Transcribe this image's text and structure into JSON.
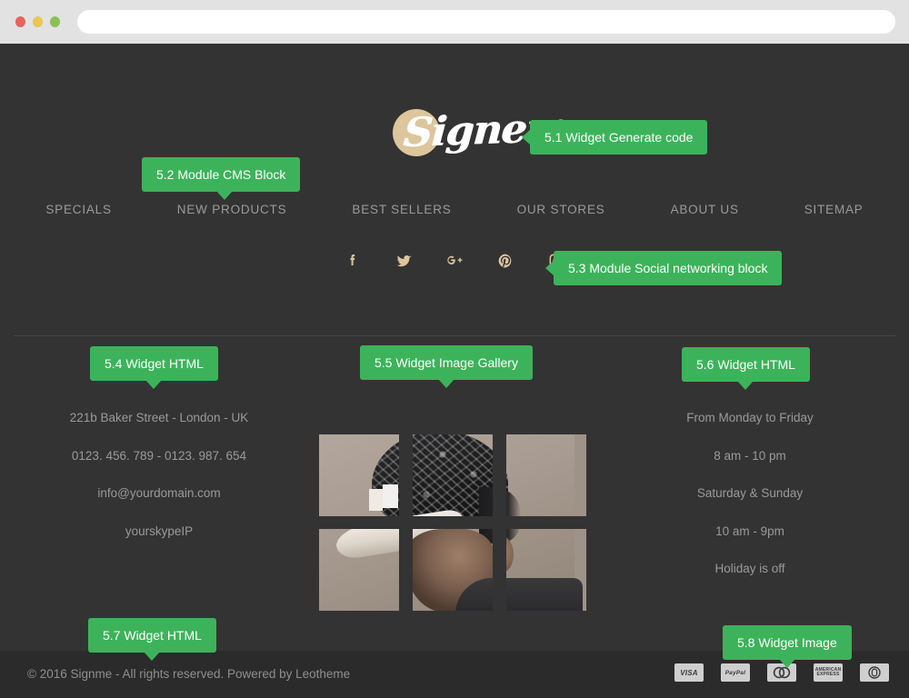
{
  "browser": {
    "url_value": "",
    "url_placeholder": "",
    "buttons": [
      "close",
      "minimize",
      "maximize"
    ]
  },
  "site": {
    "logo_text": "Signem",
    "nav": [
      {
        "label": "SPECIALS"
      },
      {
        "label": "NEW PRODUCTS"
      },
      {
        "label": "BEST SELLERS"
      },
      {
        "label": "OUR STORES"
      },
      {
        "label": "ABOUT US"
      },
      {
        "label": "SITEMAP"
      }
    ],
    "socials": [
      {
        "name": "facebook-icon",
        "label": "Facebook"
      },
      {
        "name": "twitter-icon",
        "label": "Twitter"
      },
      {
        "name": "google-plus-icon",
        "label": "Google Plus"
      },
      {
        "name": "pinterest-icon",
        "label": "Pinterest"
      },
      {
        "name": "instagram-icon",
        "label": "Instagram"
      }
    ],
    "contact": {
      "address": "221b Baker Street - London - UK",
      "phone": "0123. 456. 789 - 0123. 987. 654",
      "email": "info@yourdomain.com",
      "skype": "yourskypeIP"
    },
    "hours": {
      "line1": "From Monday to Friday",
      "line2": "8 am - 10 pm",
      "line3": "Saturday & Sunday",
      "line4": "10 am - 9pm",
      "line5": "Holiday is off"
    },
    "gallery": {
      "tiles": [
        {
          "alt": "gallery-tile-1"
        },
        {
          "alt": "gallery-tile-2"
        },
        {
          "alt": "gallery-tile-3"
        },
        {
          "alt": "gallery-tile-4"
        },
        {
          "alt": "gallery-tile-5"
        },
        {
          "alt": "gallery-tile-6"
        }
      ]
    },
    "footer": {
      "copyright": "© 2016 Signme - All rights reserved. Powered by Leotheme",
      "payments": [
        {
          "name": "visa-icon",
          "label": "VISA"
        },
        {
          "name": "paypal-icon",
          "label": "PayPal"
        },
        {
          "name": "mastercard-icon",
          "label": ""
        },
        {
          "name": "amex-icon",
          "label": "AMERICAN EXPRESS"
        },
        {
          "name": "diners-club-icon",
          "label": ""
        }
      ]
    }
  },
  "callouts": {
    "c51": "5.1 Widget Generate code",
    "c52": "5.2 Module CMS Block",
    "c53": "5.3 Module Social networking block",
    "c54": "5.4 Widget HTML",
    "c55": "5.5 Widget Image Gallery",
    "c56": "5.6 Widget HTML",
    "c57": "5.7 Widget HTML",
    "c58": "5.8 Widget Image"
  },
  "colors": {
    "accent_green": "#3cb35a",
    "page_bg": "#333333",
    "footer_bg": "#2b2b2b",
    "muted_text": "#9a9a9a",
    "logo_tan": "#ddc69c",
    "chrome_bg": "#e2e2e2"
  }
}
